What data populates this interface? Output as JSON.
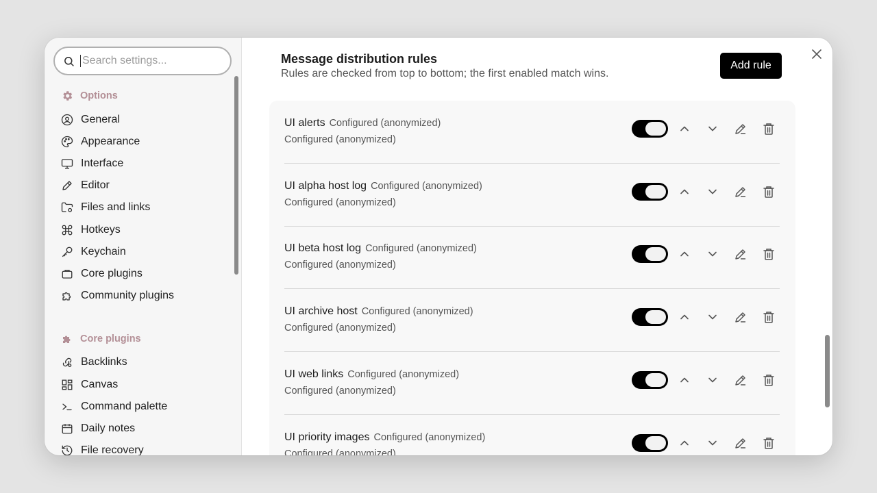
{
  "search": {
    "placeholder": "Search settings..."
  },
  "sidebar": {
    "options_header": "Options",
    "options_items": [
      {
        "label": "General",
        "icon": "user-circle-icon"
      },
      {
        "label": "Appearance",
        "icon": "palette-icon"
      },
      {
        "label": "Interface",
        "icon": "monitor-icon"
      },
      {
        "label": "Editor",
        "icon": "pencil-icon"
      },
      {
        "label": "Files and links",
        "icon": "folder-cog-icon"
      },
      {
        "label": "Hotkeys",
        "icon": "command-icon"
      },
      {
        "label": "Keychain",
        "icon": "key-icon"
      },
      {
        "label": "Core plugins",
        "icon": "briefcase-icon"
      },
      {
        "label": "Community plugins",
        "icon": "puzzle-icon"
      }
    ],
    "core_header": "Core plugins",
    "core_items": [
      {
        "label": "Backlinks",
        "icon": "link-search-icon"
      },
      {
        "label": "Canvas",
        "icon": "layout-dashboard-icon"
      },
      {
        "label": "Command palette",
        "icon": "terminal-icon"
      },
      {
        "label": "Daily notes",
        "icon": "calendar-icon"
      },
      {
        "label": "File recovery",
        "icon": "history-icon"
      }
    ]
  },
  "main": {
    "title": "Message distribution rules",
    "description": "Rules are checked from top to bottom; the first enabled match wins.",
    "add_label": "Add rule",
    "rules": [
      {
        "name": "UI alerts",
        "tag": "Configured (anonymized)",
        "sub": "Configured (anonymized)",
        "enabled": true
      },
      {
        "name": "UI alpha host log",
        "tag": "Configured (anonymized)",
        "sub": "Configured (anonymized)",
        "enabled": true
      },
      {
        "name": "UI beta host log",
        "tag": "Configured (anonymized)",
        "sub": "Configured (anonymized)",
        "enabled": true
      },
      {
        "name": "UI archive host",
        "tag": "Configured (anonymized)",
        "sub": "Configured (anonymized)",
        "enabled": true
      },
      {
        "name": "UI web links",
        "tag": "Configured (anonymized)",
        "sub": "Configured (anonymized)",
        "enabled": true
      },
      {
        "name": "UI priority images",
        "tag": "Configured (anonymized)",
        "sub": "Configured (anonymized)",
        "enabled": true
      }
    ]
  },
  "colors": {
    "accent_header": "#b38f96",
    "primary": "#000000"
  }
}
